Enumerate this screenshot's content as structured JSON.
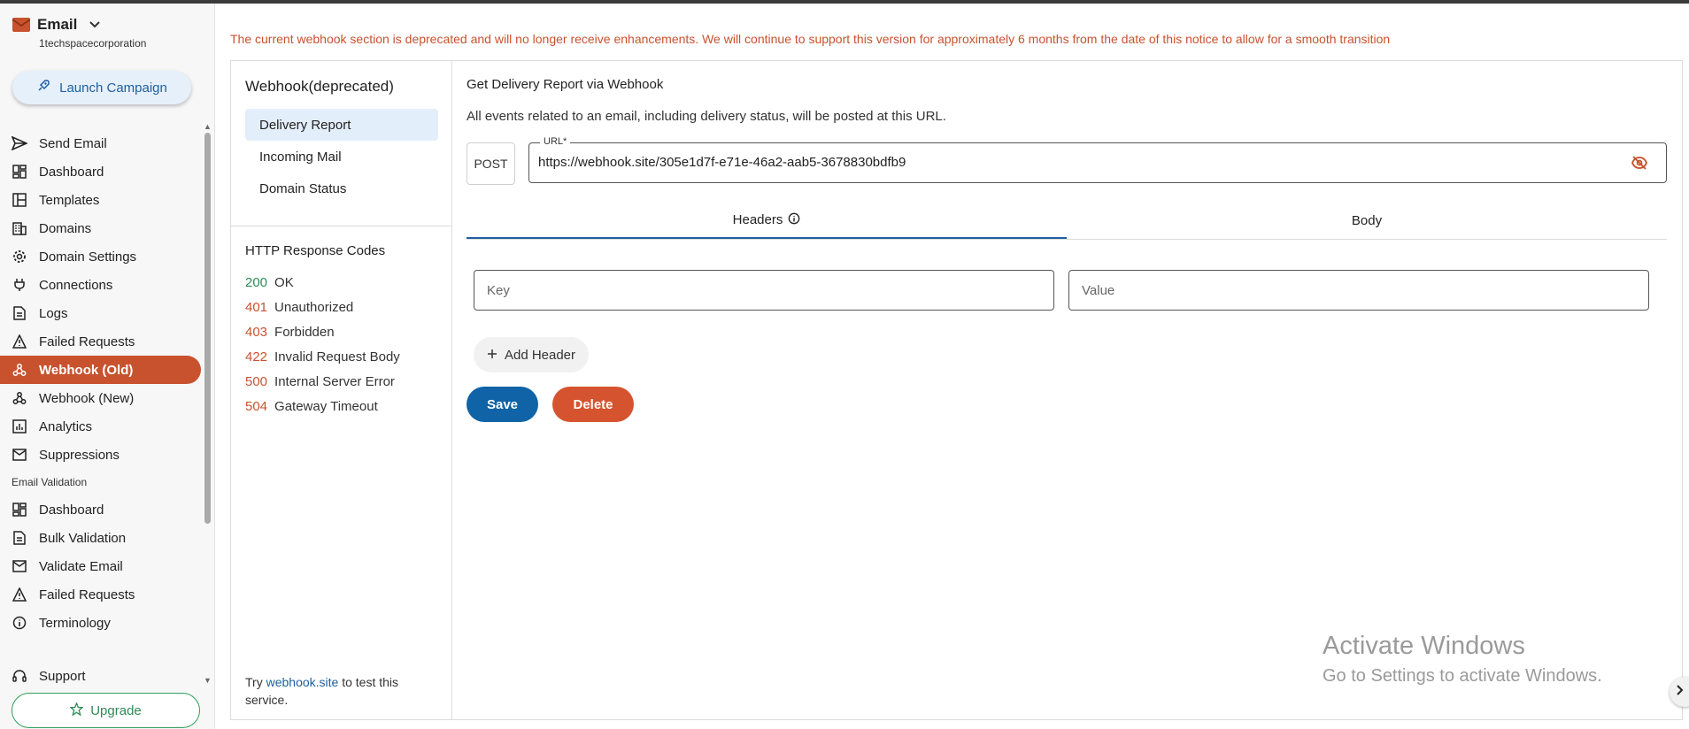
{
  "sidebar": {
    "brand_title": "Email",
    "org_name": "1techspacecorporation",
    "launch_label": "Launch Campaign",
    "items": [
      {
        "label": "Send Email",
        "icon": "send-icon"
      },
      {
        "label": "Dashboard",
        "icon": "dashboard-icon"
      },
      {
        "label": "Templates",
        "icon": "templates-icon"
      },
      {
        "label": "Domains",
        "icon": "domains-icon"
      },
      {
        "label": "Domain Settings",
        "icon": "gear-icon"
      },
      {
        "label": "Connections",
        "icon": "plug-icon"
      },
      {
        "label": "Logs",
        "icon": "document-icon"
      },
      {
        "label": "Failed Requests",
        "icon": "warning-icon"
      },
      {
        "label": "Webhook (Old)",
        "icon": "webhook-icon",
        "active": true
      },
      {
        "label": "Webhook (New)",
        "icon": "webhook-icon"
      },
      {
        "label": "Analytics",
        "icon": "analytics-icon"
      },
      {
        "label": "Suppressions",
        "icon": "mail-off-icon"
      }
    ],
    "section_label": "Email Validation",
    "validation_items": [
      {
        "label": "Dashboard",
        "icon": "dashboard-icon"
      },
      {
        "label": "Bulk Validation",
        "icon": "document-icon"
      },
      {
        "label": "Validate Email",
        "icon": "mail-icon"
      },
      {
        "label": "Failed Requests",
        "icon": "warning-icon"
      },
      {
        "label": "Terminology",
        "icon": "info-icon"
      }
    ],
    "support_label": "Support",
    "upgrade_label": "Upgrade"
  },
  "notice": "The current webhook section is deprecated and will no longer receive enhancements. We will continue to support this version for approximately 6 months from the date of this notice to allow for a smooth transition",
  "left_panel": {
    "title": "Webhook(deprecated)",
    "items": [
      {
        "label": "Delivery Report",
        "active": true
      },
      {
        "label": "Incoming Mail"
      },
      {
        "label": "Domain Status"
      }
    ],
    "codes_title": "HTTP Response Codes",
    "codes": [
      {
        "code": "200",
        "text": "OK",
        "kind": "ok"
      },
      {
        "code": "401",
        "text": "Unauthorized",
        "kind": "err"
      },
      {
        "code": "403",
        "text": "Forbidden",
        "kind": "err"
      },
      {
        "code": "422",
        "text": "Invalid Request Body",
        "kind": "err"
      },
      {
        "code": "500",
        "text": "Internal Server Error",
        "kind": "err"
      },
      {
        "code": "504",
        "text": "Gateway Timeout",
        "kind": "err"
      }
    ],
    "try_prefix": "Try ",
    "try_link": "webhook.site",
    "try_suffix": " to test this service."
  },
  "main": {
    "title": "Get Delivery Report via Webhook",
    "description": "All events related to an email, including delivery status, will be posted at this URL.",
    "method": "POST",
    "url_label": "URL*",
    "url_value": "https://webhook.site/305e1d7f-e71e-46a2-aab5-3678830bdfb9",
    "tabs": [
      {
        "label": "Headers",
        "active": true
      },
      {
        "label": "Body"
      }
    ],
    "key_placeholder": "Key",
    "value_placeholder": "Value",
    "add_header_label": "Add Header",
    "save_label": "Save",
    "delete_label": "Delete"
  },
  "watermark": {
    "title": "Activate Windows",
    "subtitle": "Go to Settings to activate Windows."
  },
  "colors": {
    "accent": "#c8522e",
    "primary": "#0f63a6",
    "success": "#2e8b57"
  }
}
